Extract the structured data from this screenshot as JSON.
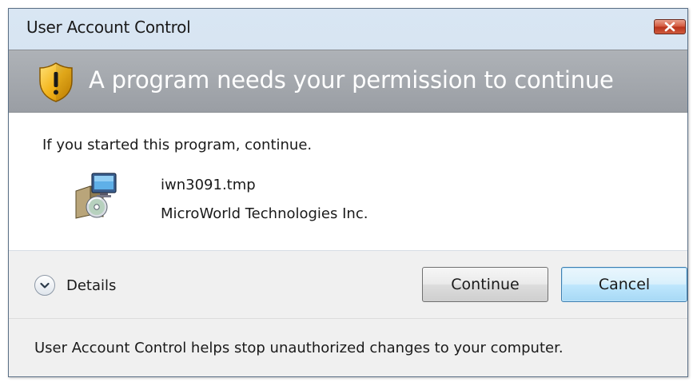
{
  "window": {
    "title": "User Account Control",
    "close_icon": "close-icon"
  },
  "banner": {
    "icon": "shield-warning-icon",
    "heading": "A program needs your permission to continue"
  },
  "content": {
    "instruction": "If you started this program, continue.",
    "program": {
      "icon": "installer-icon",
      "name": "iwn3091.tmp",
      "publisher": "MicroWorld Technologies Inc."
    }
  },
  "controls": {
    "details_label": "Details",
    "details_icon": "chevron-down-icon",
    "continue_label": "Continue",
    "cancel_label": "Cancel"
  },
  "footer": {
    "text": "User Account Control helps stop unauthorized changes to your computer."
  },
  "colors": {
    "banner": "#a3a7ac",
    "close_button": "#c9472c",
    "shield": "#f0b21a",
    "default_button_border": "#3c7fb1"
  }
}
